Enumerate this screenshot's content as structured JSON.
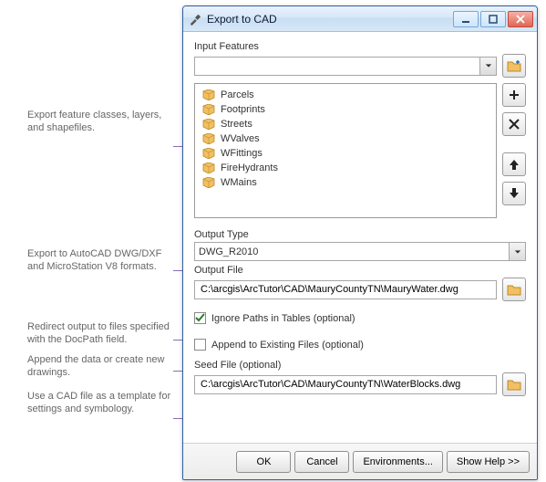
{
  "window": {
    "title": "Export to CAD"
  },
  "inputFeatures": {
    "label": "Input Features",
    "value": "",
    "items": [
      "Parcels",
      "Footprints",
      "Streets",
      "WValves",
      "WFittings",
      "FireHydrants",
      "WMains"
    ]
  },
  "outputType": {
    "label": "Output Type",
    "value": "DWG_R2010"
  },
  "outputFile": {
    "label": "Output File",
    "value": "C:\\arcgis\\ArcTutor\\CAD\\MauryCountyTN\\MauryWater.dwg"
  },
  "options": {
    "ignorePaths": {
      "label": "Ignore Paths in Tables (optional)",
      "checked": true
    },
    "appendExisting": {
      "label": "Append to Existing Files (optional)",
      "checked": false
    }
  },
  "seedFile": {
    "label": "Seed File (optional)",
    "value": "C:\\arcgis\\ArcTutor\\CAD\\MauryCountyTN\\WaterBlocks.dwg"
  },
  "buttons": {
    "ok": "OK",
    "cancel": "Cancel",
    "env": "Environments...",
    "help": "Show Help >>"
  },
  "callouts": [
    "Export feature classes, layers, and shapefiles.",
    "Export to AutoCAD DWG/DXF and MicroStation V8 formats.",
    "Redirect output to files specified with the DocPath field.",
    "Append the data or create new drawings.",
    "Use a CAD file as a template for settings and symbology."
  ]
}
